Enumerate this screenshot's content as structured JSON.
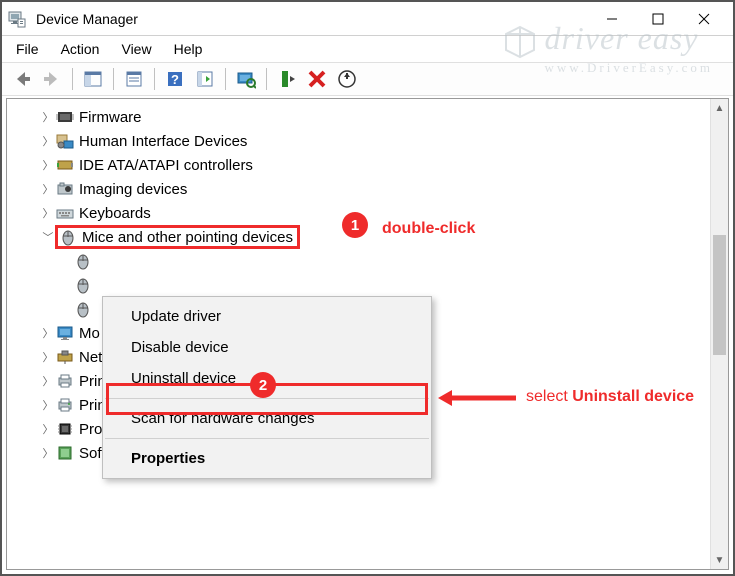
{
  "window": {
    "title": "Device Manager"
  },
  "menubar": {
    "file": "File",
    "action": "Action",
    "view": "View",
    "help": "Help"
  },
  "tree": {
    "firmware": "Firmware",
    "hid": "Human Interface Devices",
    "ide": "IDE ATA/ATAPI controllers",
    "imaging": "Imaging devices",
    "keyboards": "Keyboards",
    "mice": "Mice and other pointing devices",
    "mouse_child1": "",
    "mouse_child2": "",
    "mouse_child3": "",
    "monitors": "Mo",
    "network": "Net",
    "printqueues": "Prin",
    "printers": "Prin",
    "processors": "Proc",
    "software": "Software components"
  },
  "contextmenu": {
    "update": "Update driver",
    "disable": "Disable device",
    "uninstall": "Uninstall device",
    "scan": "Scan for hardware changes",
    "properties": "Properties"
  },
  "annotations": {
    "badge1": "1",
    "badge2": "2",
    "hint1": "double-click",
    "hint2_prefix": "select ",
    "hint2_bold": "Uninstall device"
  },
  "watermark": {
    "brand": "driver easy",
    "site": "www.DriverEasy.com"
  }
}
